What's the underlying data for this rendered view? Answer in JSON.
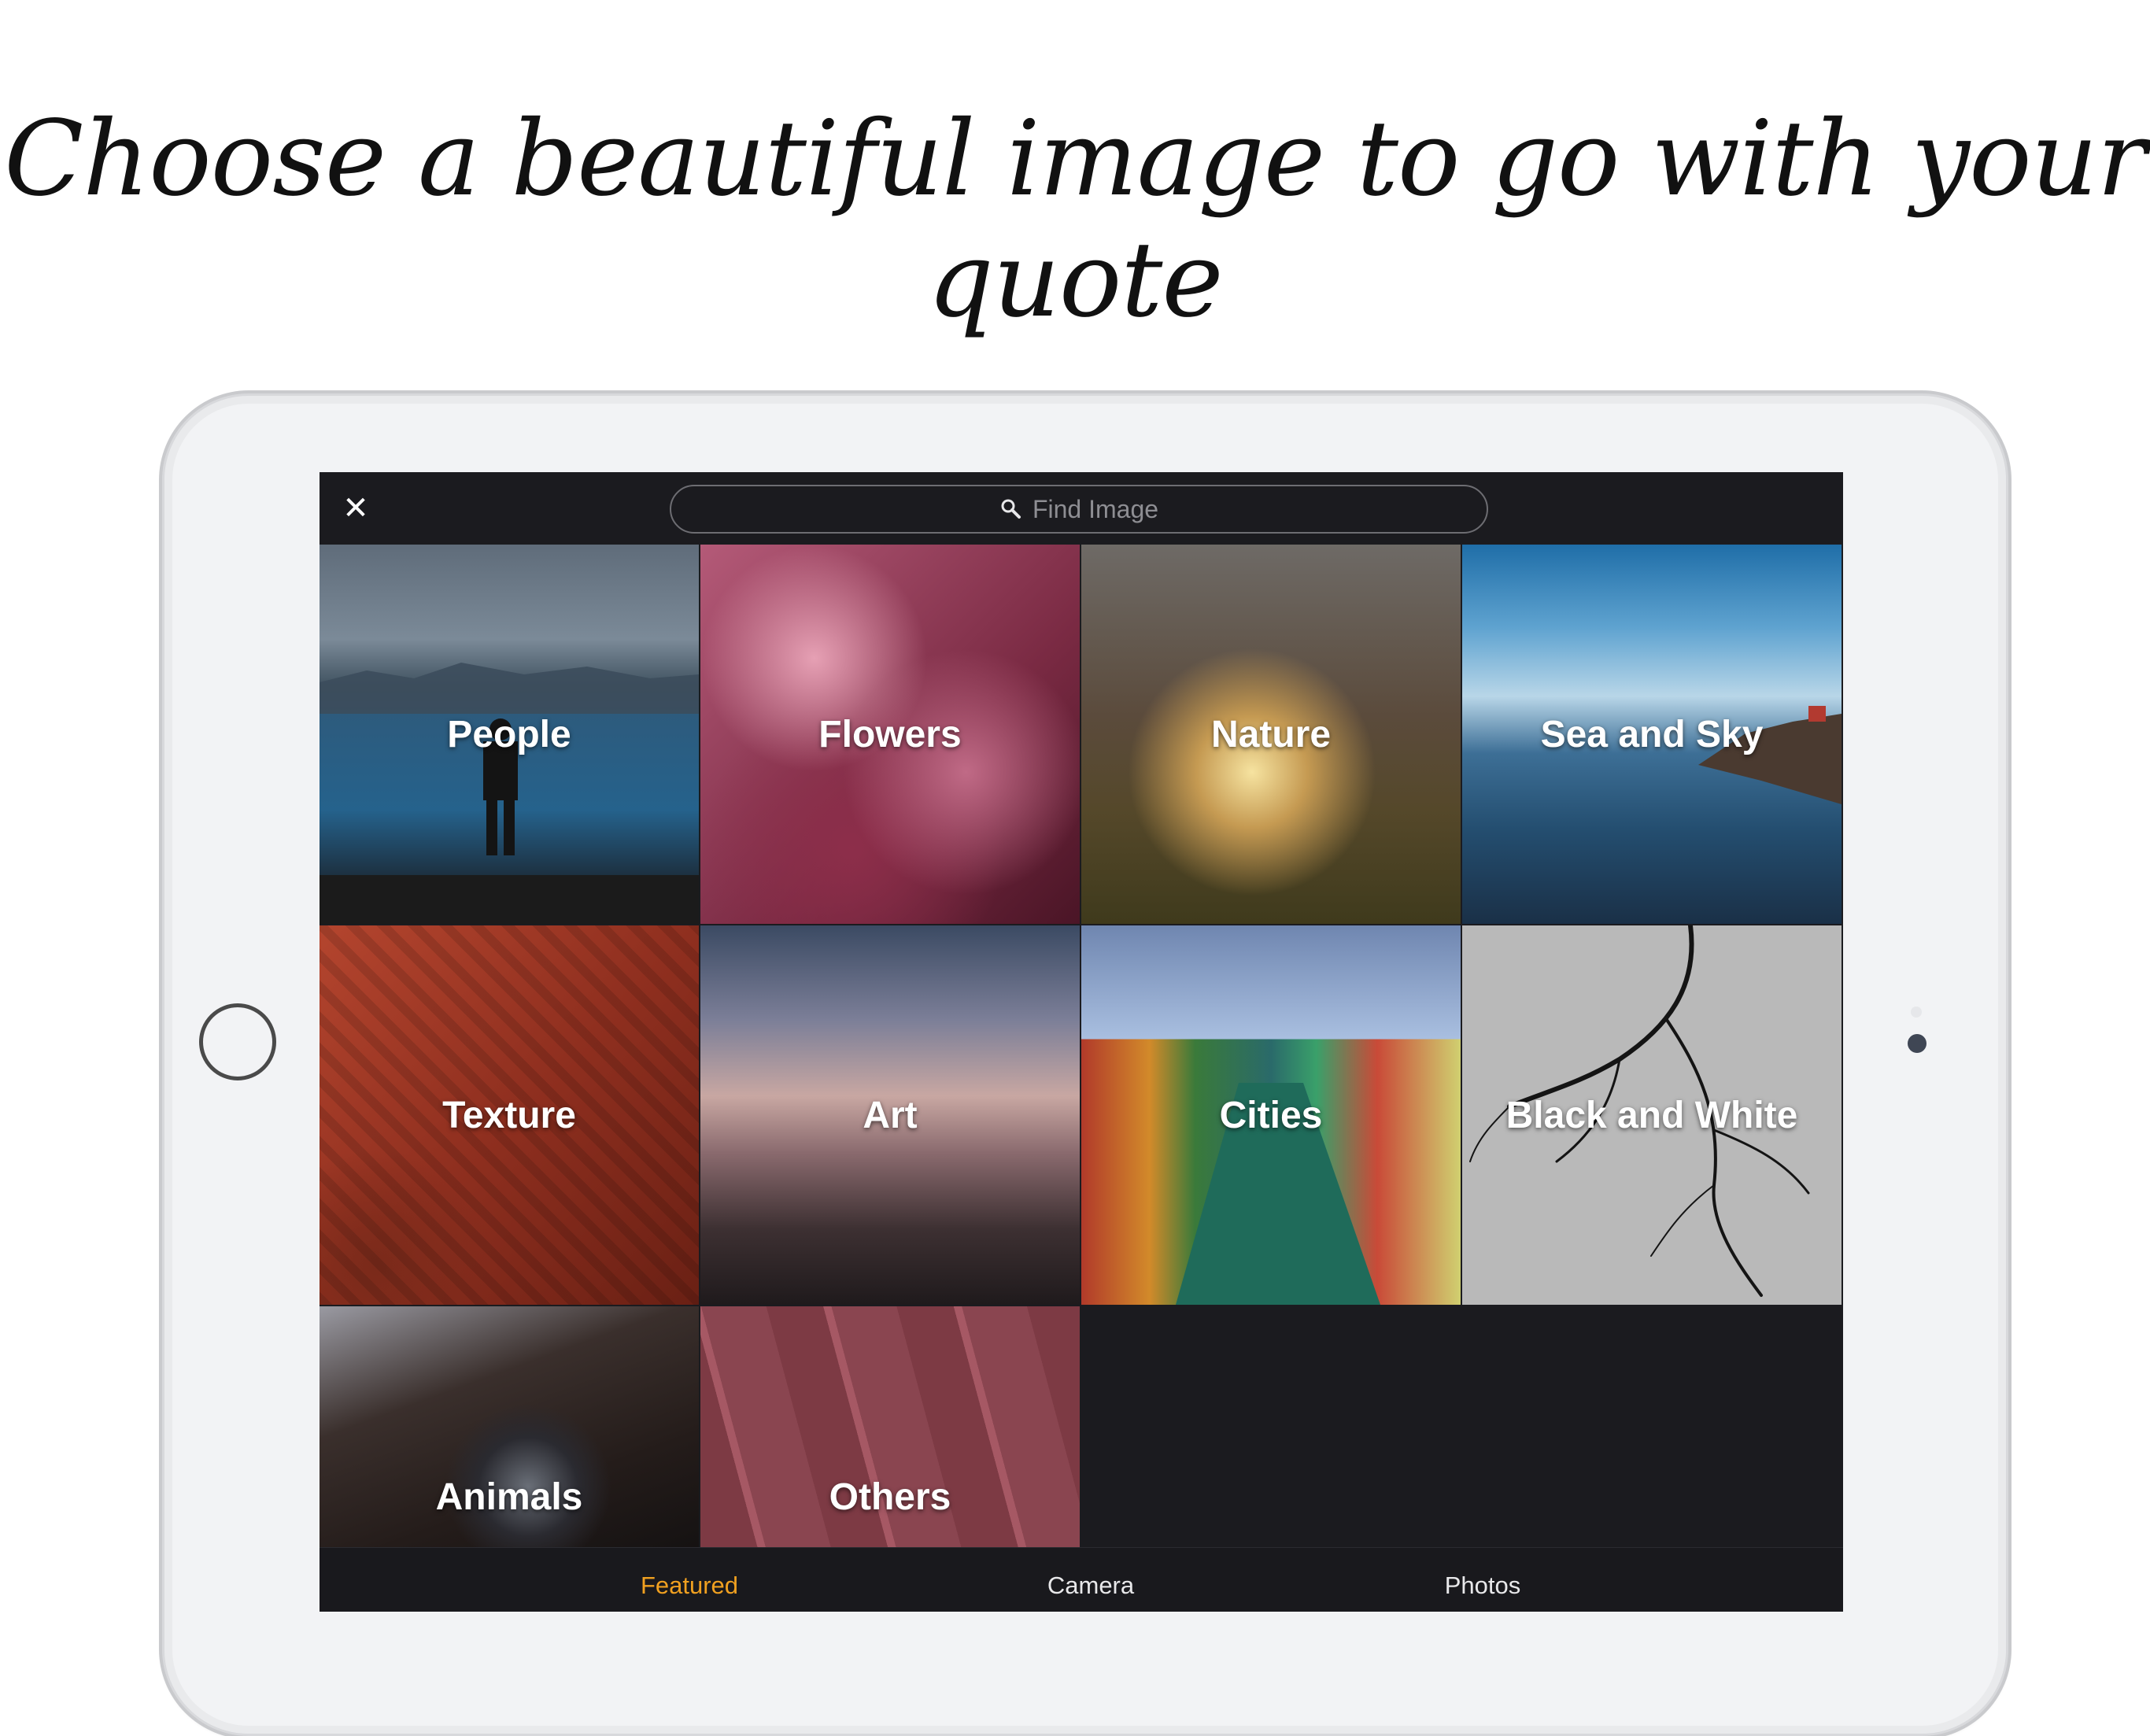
{
  "headline": "Choose a beautiful image to go with your quote",
  "topbar": {
    "close_icon": "close-icon",
    "search_placeholder": "Find Image"
  },
  "categories": [
    {
      "label": "People"
    },
    {
      "label": "Flowers"
    },
    {
      "label": "Nature"
    },
    {
      "label": "Sea and Sky"
    },
    {
      "label": "Texture"
    },
    {
      "label": "Art"
    },
    {
      "label": "Cities"
    },
    {
      "label": "Black and White"
    },
    {
      "label": "Animals"
    },
    {
      "label": "Others"
    }
  ],
  "tabs": [
    {
      "label": "Featured",
      "active": true
    },
    {
      "label": "Camera",
      "active": false
    },
    {
      "label": "Photos",
      "active": false
    }
  ],
  "colors": {
    "active_tab": "#f0a020",
    "screen_bg": "#1b1b1f",
    "device_body": "#f2f3f5"
  }
}
